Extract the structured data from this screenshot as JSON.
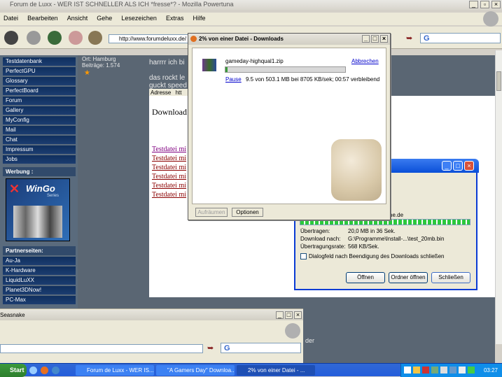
{
  "browser": {
    "title": "Forum de Luxx - WER IST SCHNELLER ALS ICH *fresse*? - Mozilla Powertuna",
    "menu": [
      "Datei",
      "Bearbeiten",
      "Ansicht",
      "Gehe",
      "Lesezeichen",
      "Extras",
      "Hilfe"
    ],
    "url": "http://www.forumdeluxx.de/",
    "search_icon": "G"
  },
  "sidebar": {
    "items": [
      "Testdatenbank",
      "PerfectGPU",
      "Glossary",
      "PerfectBoard",
      "Forum",
      "Gallery",
      "MyConfig",
      "Mail",
      "Chat",
      "Impressum",
      "Jobs"
    ],
    "werbung_label": "Werbung :",
    "banner_text": "WinGo",
    "banner_sub": "Series",
    "partner_label": "Partnerseiten:",
    "partners": [
      "Au-Ja",
      "K-Hardware",
      "LiquidLuXX",
      "Planet3DNow!",
      "PC-Max"
    ]
  },
  "user": {
    "ort": "Ort: Hamburg",
    "beitraege": "Beiträge: 1.574"
  },
  "post": {
    "line1": "harrrr ich bi",
    "line2": "das rockt le",
    "line3": "guckt speed",
    "adresse_label": "Adresse",
    "adresse_value": "htt",
    "download_heading": "Download",
    "links": [
      "Testdatei mi",
      "Testdatei mi",
      "Testdatei mi",
      "Testdatei mi",
      "Testdatei mi",
      "Testdatei mi"
    ]
  },
  "downloads": {
    "title": "2% von einer Datei - Downloads",
    "filename": "gameday-highqual1.zip",
    "cancel": "Abbrechen",
    "pause": "Pause",
    "status": "9.5 von 503.1 MB bei 8705 KB/sek; 00:57 verbleibend",
    "progress": 0.02,
    "clear_button": "Aufräumen",
    "options_button": "Optionen"
  },
  "xp_dialog": {
    "url_fragment": "ne.de",
    "rows": [
      {
        "label": "Übertragen:",
        "value": "20,0 MB in 36 Sek."
      },
      {
        "label": "Download nach:",
        "value": "G:\\Programme\\Install-...\\test_20mb.bin"
      },
      {
        "label": "Übertragungsrate:",
        "value": "568 KB/Sek."
      }
    ],
    "checkbox_label": "Dialogfeld nach Beendigung des Downloads schließen",
    "open_button": "Öffnen",
    "open_folder_button": "Ordner öffnen",
    "close_button": "Schließen"
  },
  "second_window": {
    "title": "Seasnake",
    "side_text": "der"
  },
  "taskbar": {
    "start": "Start",
    "tasks": [
      "Forum de Luxx - WER IS...",
      "\"A Gamers Day\" Downloa...",
      "2% von einer Datei - ..."
    ],
    "clock": "03:27"
  }
}
